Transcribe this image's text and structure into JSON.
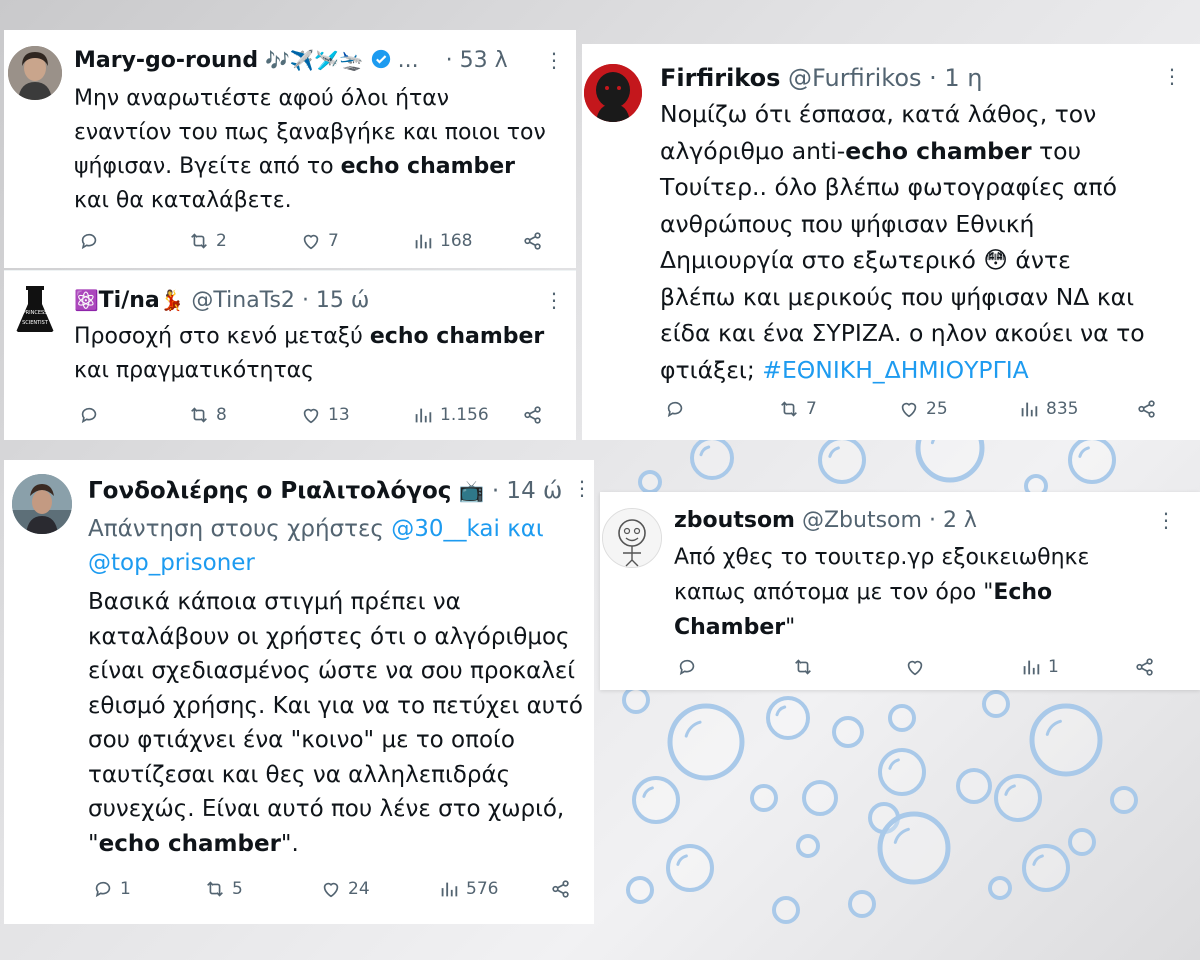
{
  "tweets": {
    "mary": {
      "name": "Mary-go-round",
      "emojis": "🎶✈️🛩️🛬",
      "ellipsis": "...",
      "time": "· 53 λ",
      "text": [
        "Μην αναρωτιέστε αφού όλοι ήταν",
        "εναντίον του πως ξαναβγήκε και ποιοι τον",
        "ψήφισαν. Βγείτε από το ",
        "echo chamber",
        "και θα καταλάβετε."
      ],
      "retweets": "2",
      "likes": "7",
      "views": "168"
    },
    "tina": {
      "name": "Ti/na",
      "prefix_emoji": "⚛️",
      "suffix_emoji": "💃",
      "handle": "@TinaTs2",
      "time": "· 15 ώ",
      "text": [
        "Προσοχή στο κενό μεταξύ ",
        "echo chamber",
        "και πραγματικότητας"
      ],
      "retweets": "8",
      "likes": "13",
      "views": "1.156"
    },
    "firfirikos": {
      "name": "Firfirikos",
      "handle": "@Furfirikos",
      "time": "· 1 η",
      "text": [
        "Νομίζω ότι έσπασα, κατά λάθος, τον",
        "αλγόριθμο anti-",
        "echo chamber",
        " του",
        "Τουίτερ.. όλο βλέπω φωτογραφίες από",
        "ανθρώπους που ψήφισαν Εθνική",
        "Δημιουργία στο εξωτερικό ",
        "😳",
        " άντε",
        "βλέπω και μερικούς που ψήφισαν ΝΔ και",
        "είδα και ένα ΣΥΡΙΖΑ. ο ηλον ακούει να το",
        "φτιάξει; ",
        "#ΕΘΝΙΚΗ_ΔΗΜΙΟΥΡΓΙΑ"
      ],
      "retweets": "7",
      "likes": "25",
      "views": "835"
    },
    "gondolieris": {
      "name": "Γονδολιέρης ο Ριαλιτολόγος",
      "tv_emoji": "📺",
      "time": "· 14 ώ",
      "reply_prefix": "Απάντηση στους χρήστες ",
      "reply_user1": "@30__kai",
      "reply_and": " και",
      "reply_user2": "@top_prisoner",
      "text": [
        "Βασικά κάποια στιγμή  πρέπει να",
        "καταλάβουν οι χρήστες ότι ο αλγόριθμος",
        "είναι σχεδιασμένος ώστε να σου προκαλεί",
        "εθισμό χρήσης. Και για να το πετύχει αυτό",
        "σου φτιάχνει ένα \"κοινο\" με το οποίο",
        "ταυτίζεσαι και θες να αλληλεπιδράς",
        "συνεχώς. Είναι αυτό που λένε στο χωριό,",
        "\"",
        "echo chamber",
        "\"."
      ],
      "replies": "1",
      "retweets": "5",
      "likes": "24",
      "views": "576"
    },
    "zboutsom": {
      "name": "zboutsom",
      "handle": "@Zbutsom",
      "time": "· 2 λ",
      "text": [
        "Από χθες το τουιτερ.γρ εξοικειωθηκε",
        "καπως απότομα με τον όρο \"",
        "Echo",
        "Chamber",
        "\""
      ],
      "views": "1"
    }
  },
  "colors": {
    "text": "#0f1419",
    "meta": "#536471",
    "link": "#1d9bf0",
    "verified": "#1d9bf0",
    "bubble": "#a9c9e9"
  },
  "icons": [
    "reply-icon",
    "retweet-icon",
    "like-icon",
    "views-icon",
    "share-icon",
    "more-icon",
    "verified-icon"
  ]
}
